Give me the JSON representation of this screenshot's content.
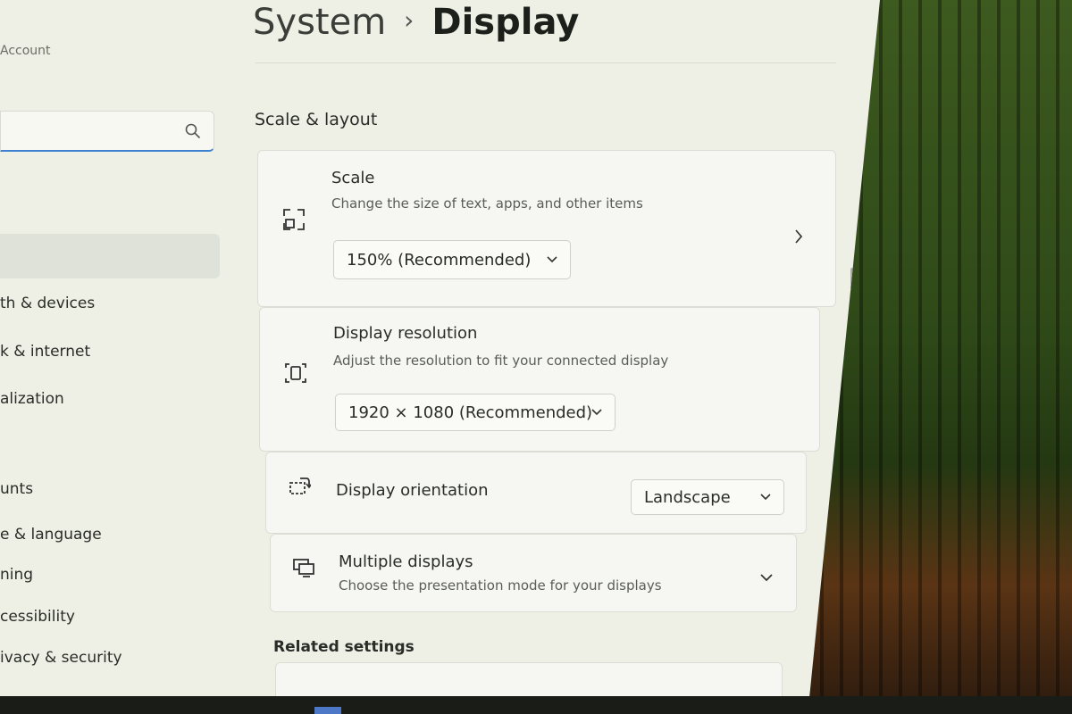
{
  "sidebar": {
    "account_label": "Account",
    "search": {
      "value": "",
      "placeholder": ""
    },
    "items": [
      {
        "label": "th & devices"
      },
      {
        "label": "k & internet"
      },
      {
        "label": "alization"
      },
      {
        "label": "unts"
      },
      {
        "label": "e & language"
      },
      {
        "label": "ning"
      },
      {
        "label": "cessibility"
      },
      {
        "label": "ivacy & security"
      }
    ]
  },
  "header": {
    "parent": "System",
    "separator": "›",
    "current": "Display"
  },
  "sections": {
    "scale_layout": {
      "title": "Scale & layout",
      "scale": {
        "title": "Scale",
        "subtitle": "Change the size of text, apps, and other items",
        "value": "150% (Recommended)"
      },
      "resolution": {
        "title": "Display resolution",
        "subtitle": "Adjust the resolution to fit your connected display",
        "value": "1920 × 1080 (Recommended)"
      },
      "orientation": {
        "title": "Display orientation",
        "value": "Landscape"
      },
      "multiple": {
        "title": "Multiple displays",
        "subtitle": "Choose the presentation mode for your displays"
      }
    },
    "related": {
      "title": "Related settings"
    }
  },
  "icons": {
    "search": "search-icon",
    "scale": "scale-icon",
    "resolution": "resolution-icon",
    "orientation": "orientation-icon",
    "multiple": "multiple-displays-icon"
  },
  "colors": {
    "accent": "#3d7fd0",
    "window_bg": "#eef0e6",
    "card_bg": "#f6f7f2"
  }
}
